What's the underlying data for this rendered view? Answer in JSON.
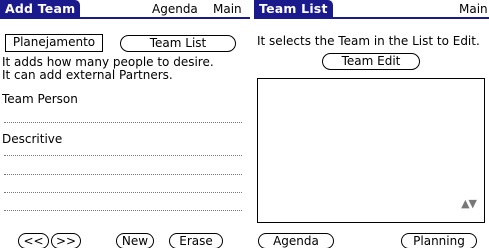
{
  "left_form": {
    "title": "Add Team",
    "menu": {
      "agenda": "Agenda",
      "main": "Main"
    },
    "category_selector": "Planejamento",
    "team_list_button": "Team List",
    "help_line1": "It adds how many people to desire.",
    "help_line2": "It can add external Partners.",
    "team_person_label": "Team Person",
    "descritive_label": "Descritive",
    "buttons": {
      "prev": "<<",
      "next": ">>",
      "new": "New",
      "erase": "Erase"
    }
  },
  "right_form": {
    "title": "Team List",
    "menu": {
      "main": "Main"
    },
    "help_text": "It selects the Team in the List to Edit.",
    "team_edit_button": "Team Edit",
    "scroll_arrows": "▲▼",
    "buttons": {
      "agenda": "Agenda",
      "planning": "Planning"
    }
  },
  "colors": {
    "titlebar": "#1a1a8c",
    "background": "#ffffff"
  }
}
